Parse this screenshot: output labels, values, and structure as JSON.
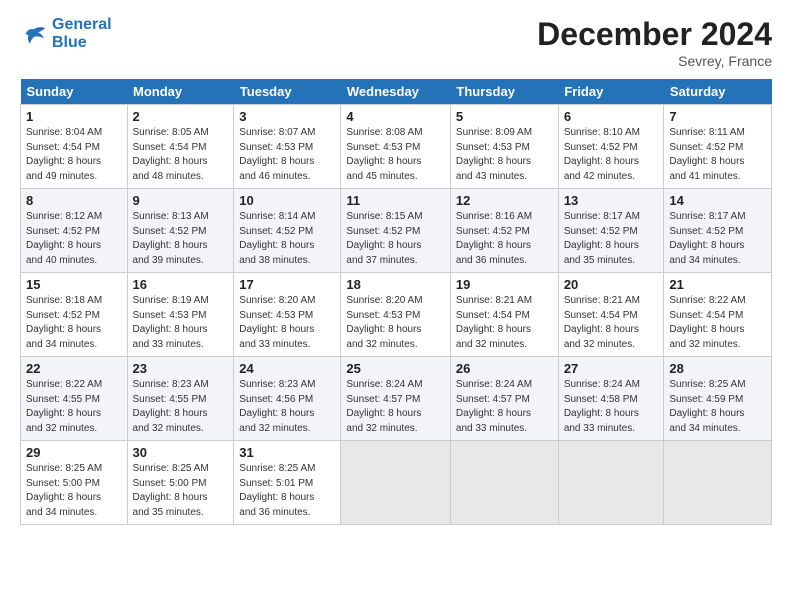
{
  "header": {
    "logo_line1": "General",
    "logo_line2": "Blue",
    "month": "December 2024",
    "location": "Sevrey, France"
  },
  "weekdays": [
    "Sunday",
    "Monday",
    "Tuesday",
    "Wednesday",
    "Thursday",
    "Friday",
    "Saturday"
  ],
  "weeks": [
    [
      {
        "day": "1",
        "sunrise": "8:04 AM",
        "sunset": "4:54 PM",
        "daylight": "8 hours and 49 minutes."
      },
      {
        "day": "2",
        "sunrise": "8:05 AM",
        "sunset": "4:54 PM",
        "daylight": "8 hours and 48 minutes."
      },
      {
        "day": "3",
        "sunrise": "8:07 AM",
        "sunset": "4:53 PM",
        "daylight": "8 hours and 46 minutes."
      },
      {
        "day": "4",
        "sunrise": "8:08 AM",
        "sunset": "4:53 PM",
        "daylight": "8 hours and 45 minutes."
      },
      {
        "day": "5",
        "sunrise": "8:09 AM",
        "sunset": "4:53 PM",
        "daylight": "8 hours and 43 minutes."
      },
      {
        "day": "6",
        "sunrise": "8:10 AM",
        "sunset": "4:52 PM",
        "daylight": "8 hours and 42 minutes."
      },
      {
        "day": "7",
        "sunrise": "8:11 AM",
        "sunset": "4:52 PM",
        "daylight": "8 hours and 41 minutes."
      }
    ],
    [
      {
        "day": "8",
        "sunrise": "8:12 AM",
        "sunset": "4:52 PM",
        "daylight": "8 hours and 40 minutes."
      },
      {
        "day": "9",
        "sunrise": "8:13 AM",
        "sunset": "4:52 PM",
        "daylight": "8 hours and 39 minutes."
      },
      {
        "day": "10",
        "sunrise": "8:14 AM",
        "sunset": "4:52 PM",
        "daylight": "8 hours and 38 minutes."
      },
      {
        "day": "11",
        "sunrise": "8:15 AM",
        "sunset": "4:52 PM",
        "daylight": "8 hours and 37 minutes."
      },
      {
        "day": "12",
        "sunrise": "8:16 AM",
        "sunset": "4:52 PM",
        "daylight": "8 hours and 36 minutes."
      },
      {
        "day": "13",
        "sunrise": "8:17 AM",
        "sunset": "4:52 PM",
        "daylight": "8 hours and 35 minutes."
      },
      {
        "day": "14",
        "sunrise": "8:17 AM",
        "sunset": "4:52 PM",
        "daylight": "8 hours and 34 minutes."
      }
    ],
    [
      {
        "day": "15",
        "sunrise": "8:18 AM",
        "sunset": "4:52 PM",
        "daylight": "8 hours and 34 minutes."
      },
      {
        "day": "16",
        "sunrise": "8:19 AM",
        "sunset": "4:53 PM",
        "daylight": "8 hours and 33 minutes."
      },
      {
        "day": "17",
        "sunrise": "8:20 AM",
        "sunset": "4:53 PM",
        "daylight": "8 hours and 33 minutes."
      },
      {
        "day": "18",
        "sunrise": "8:20 AM",
        "sunset": "4:53 PM",
        "daylight": "8 hours and 32 minutes."
      },
      {
        "day": "19",
        "sunrise": "8:21 AM",
        "sunset": "4:54 PM",
        "daylight": "8 hours and 32 minutes."
      },
      {
        "day": "20",
        "sunrise": "8:21 AM",
        "sunset": "4:54 PM",
        "daylight": "8 hours and 32 minutes."
      },
      {
        "day": "21",
        "sunrise": "8:22 AM",
        "sunset": "4:54 PM",
        "daylight": "8 hours and 32 minutes."
      }
    ],
    [
      {
        "day": "22",
        "sunrise": "8:22 AM",
        "sunset": "4:55 PM",
        "daylight": "8 hours and 32 minutes."
      },
      {
        "day": "23",
        "sunrise": "8:23 AM",
        "sunset": "4:55 PM",
        "daylight": "8 hours and 32 minutes."
      },
      {
        "day": "24",
        "sunrise": "8:23 AM",
        "sunset": "4:56 PM",
        "daylight": "8 hours and 32 minutes."
      },
      {
        "day": "25",
        "sunrise": "8:24 AM",
        "sunset": "4:57 PM",
        "daylight": "8 hours and 32 minutes."
      },
      {
        "day": "26",
        "sunrise": "8:24 AM",
        "sunset": "4:57 PM",
        "daylight": "8 hours and 33 minutes."
      },
      {
        "day": "27",
        "sunrise": "8:24 AM",
        "sunset": "4:58 PM",
        "daylight": "8 hours and 33 minutes."
      },
      {
        "day": "28",
        "sunrise": "8:25 AM",
        "sunset": "4:59 PM",
        "daylight": "8 hours and 34 minutes."
      }
    ],
    [
      {
        "day": "29",
        "sunrise": "8:25 AM",
        "sunset": "5:00 PM",
        "daylight": "8 hours and 34 minutes."
      },
      {
        "day": "30",
        "sunrise": "8:25 AM",
        "sunset": "5:00 PM",
        "daylight": "8 hours and 35 minutes."
      },
      {
        "day": "31",
        "sunrise": "8:25 AM",
        "sunset": "5:01 PM",
        "daylight": "8 hours and 36 minutes."
      },
      null,
      null,
      null,
      null
    ]
  ]
}
